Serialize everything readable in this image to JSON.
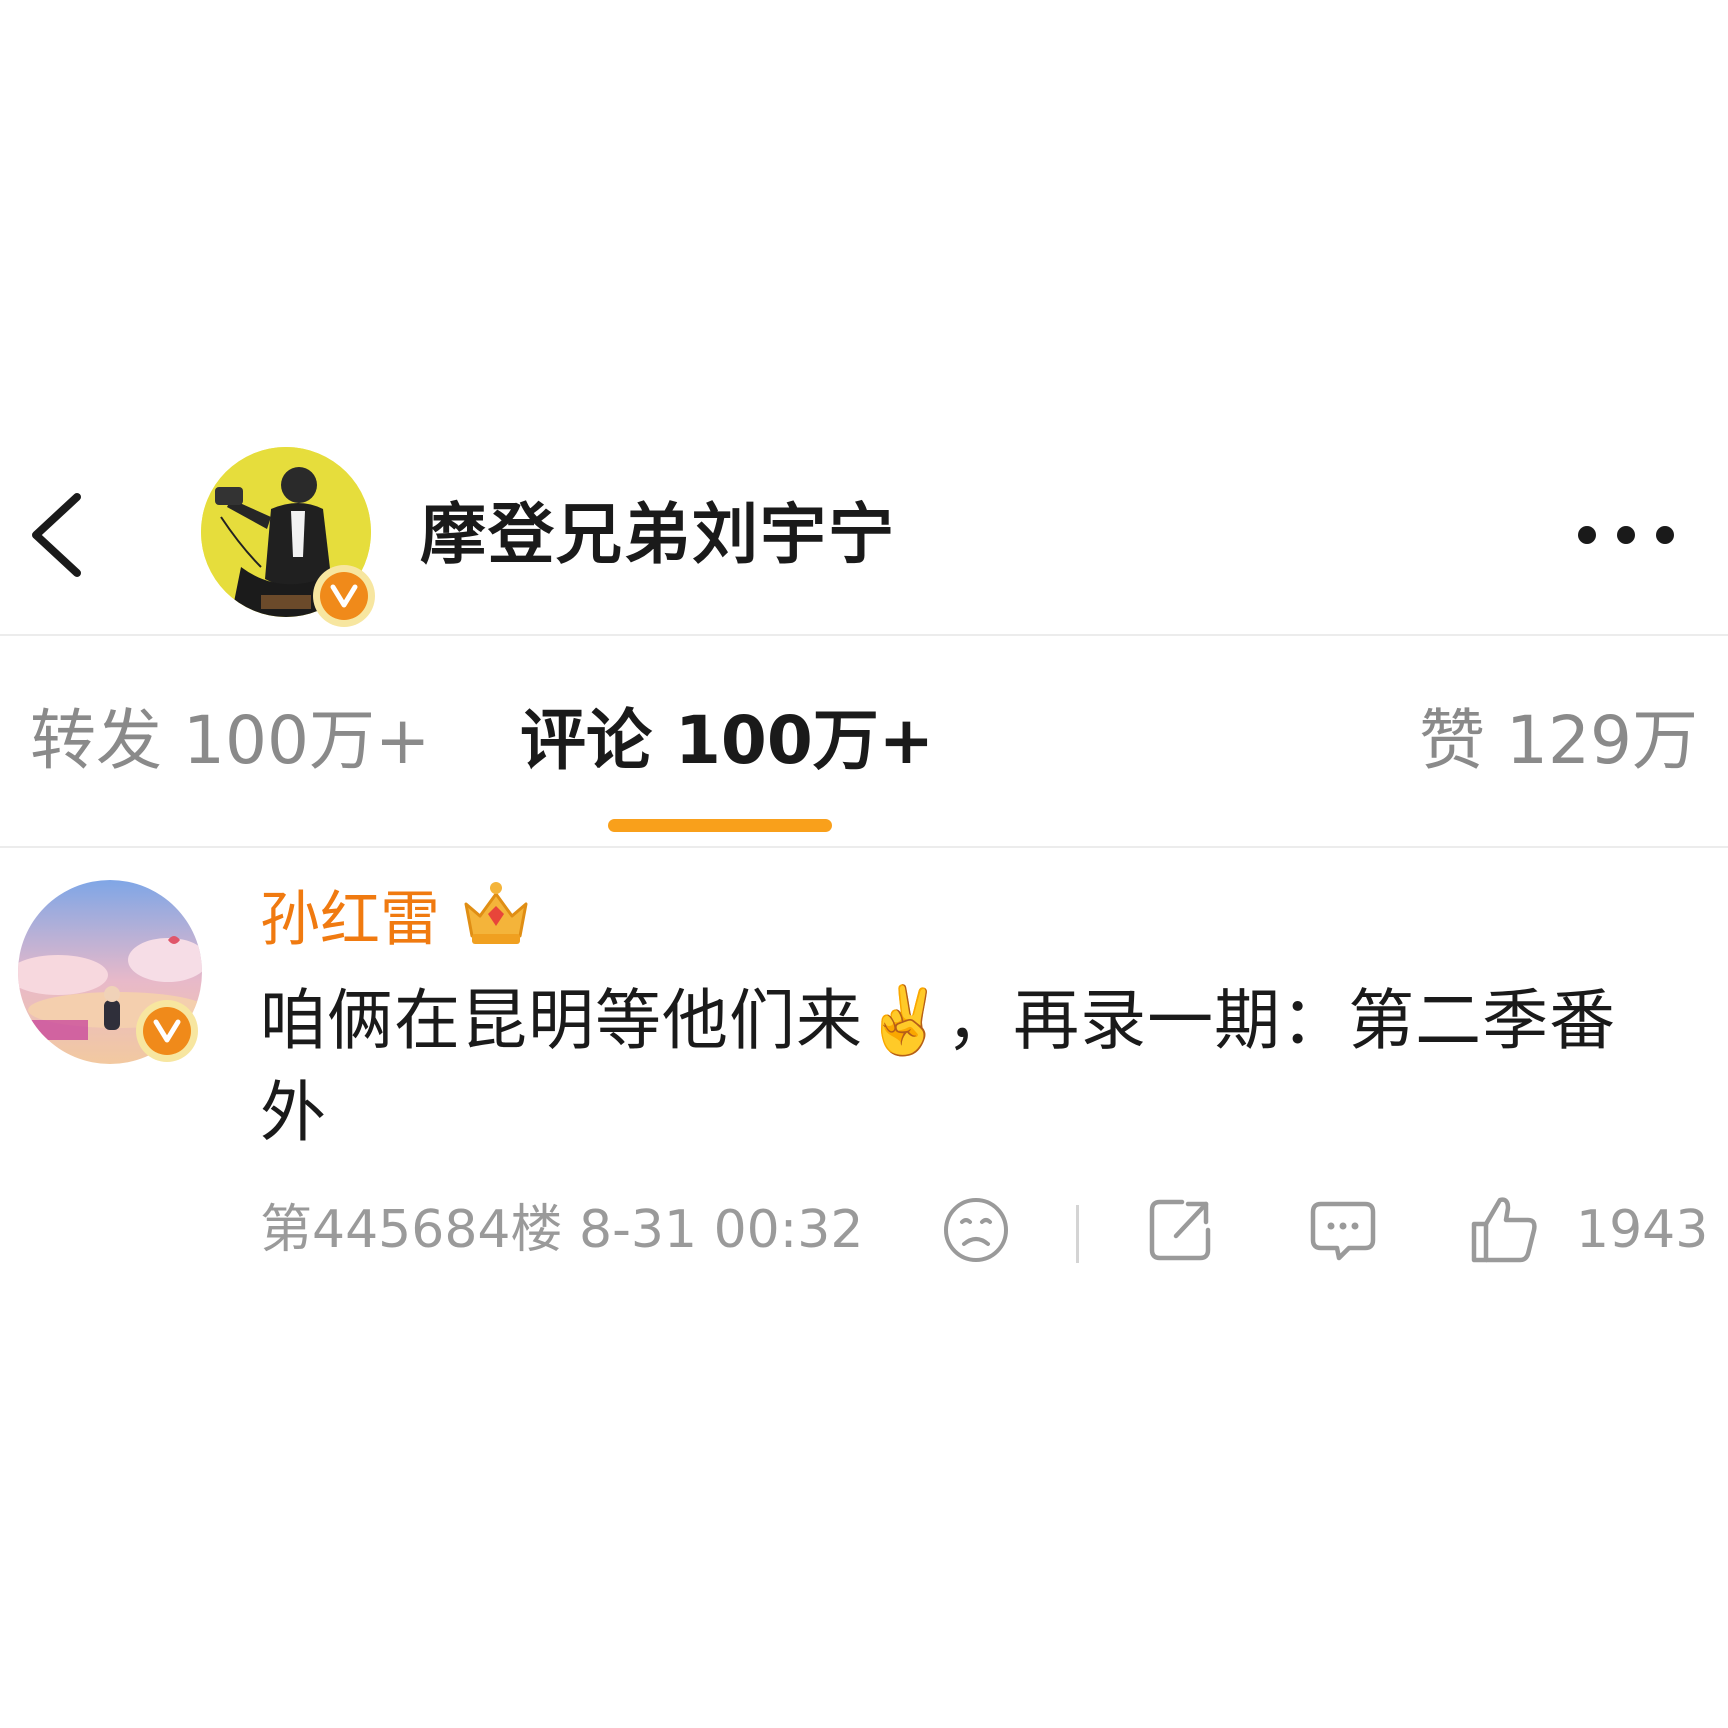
{
  "header": {
    "author_name": "摩登兄弟刘宇宁"
  },
  "icons": {
    "back": "chevron-left-icon",
    "more": "more-dots-icon",
    "verified": "verified-v-badge",
    "crown": "crown-icon",
    "dislike": "sad-face-icon",
    "share": "share-icon",
    "reply": "comment-bubble-icon",
    "like": "thumbs-up-icon"
  },
  "tabs": [
    {
      "label": "转发 100万+",
      "active": false
    },
    {
      "label": "评论 100万+",
      "active": true
    },
    {
      "label": "赞 129万",
      "active": false
    }
  ],
  "comment": {
    "username": "孙红雷",
    "text": "咱俩在昆明等他们来✌️，再录一期：第二季番外",
    "meta": "第445684楼 8-31 00:32",
    "like_count": "1943"
  },
  "colors": {
    "accent": "#f9a01b",
    "username": "#f07a10",
    "verified": "#f08a1a"
  }
}
